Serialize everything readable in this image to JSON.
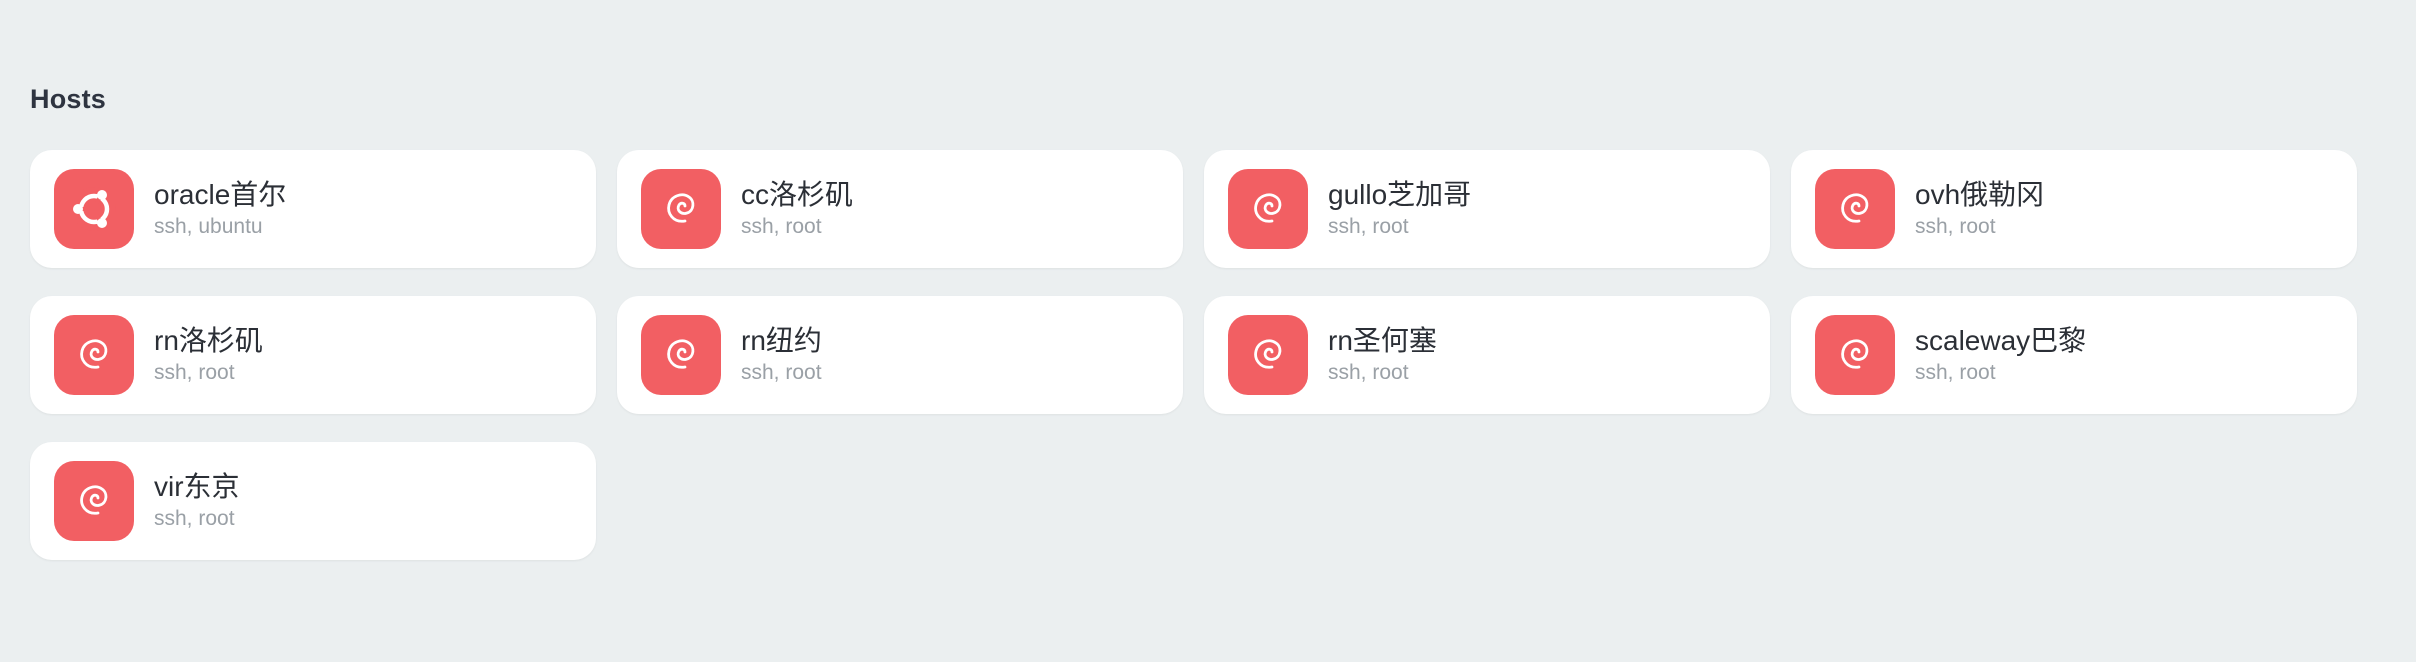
{
  "section": {
    "title": "Hosts"
  },
  "colors": {
    "background": "#ebeff0",
    "icon_tile": "#f25f63",
    "card": "#ffffff"
  },
  "hosts": [
    {
      "name": "oracle首尔",
      "details": "ssh, ubuntu",
      "icon": "ubuntu-icon"
    },
    {
      "name": "cc洛杉矶",
      "details": "ssh, root",
      "icon": "debian-icon"
    },
    {
      "name": "gullo芝加哥",
      "details": "ssh, root",
      "icon": "debian-icon"
    },
    {
      "name": "ovh俄勒冈",
      "details": "ssh, root",
      "icon": "debian-icon"
    },
    {
      "name": "rn洛杉矶",
      "details": "ssh, root",
      "icon": "debian-icon"
    },
    {
      "name": "rn纽约",
      "details": "ssh, root",
      "icon": "debian-icon"
    },
    {
      "name": "rn圣何塞",
      "details": "ssh, root",
      "icon": "debian-icon"
    },
    {
      "name": "scaleway巴黎",
      "details": "ssh, root",
      "icon": "debian-icon"
    },
    {
      "name": "vir东京",
      "details": "ssh, root",
      "icon": "debian-icon"
    }
  ]
}
